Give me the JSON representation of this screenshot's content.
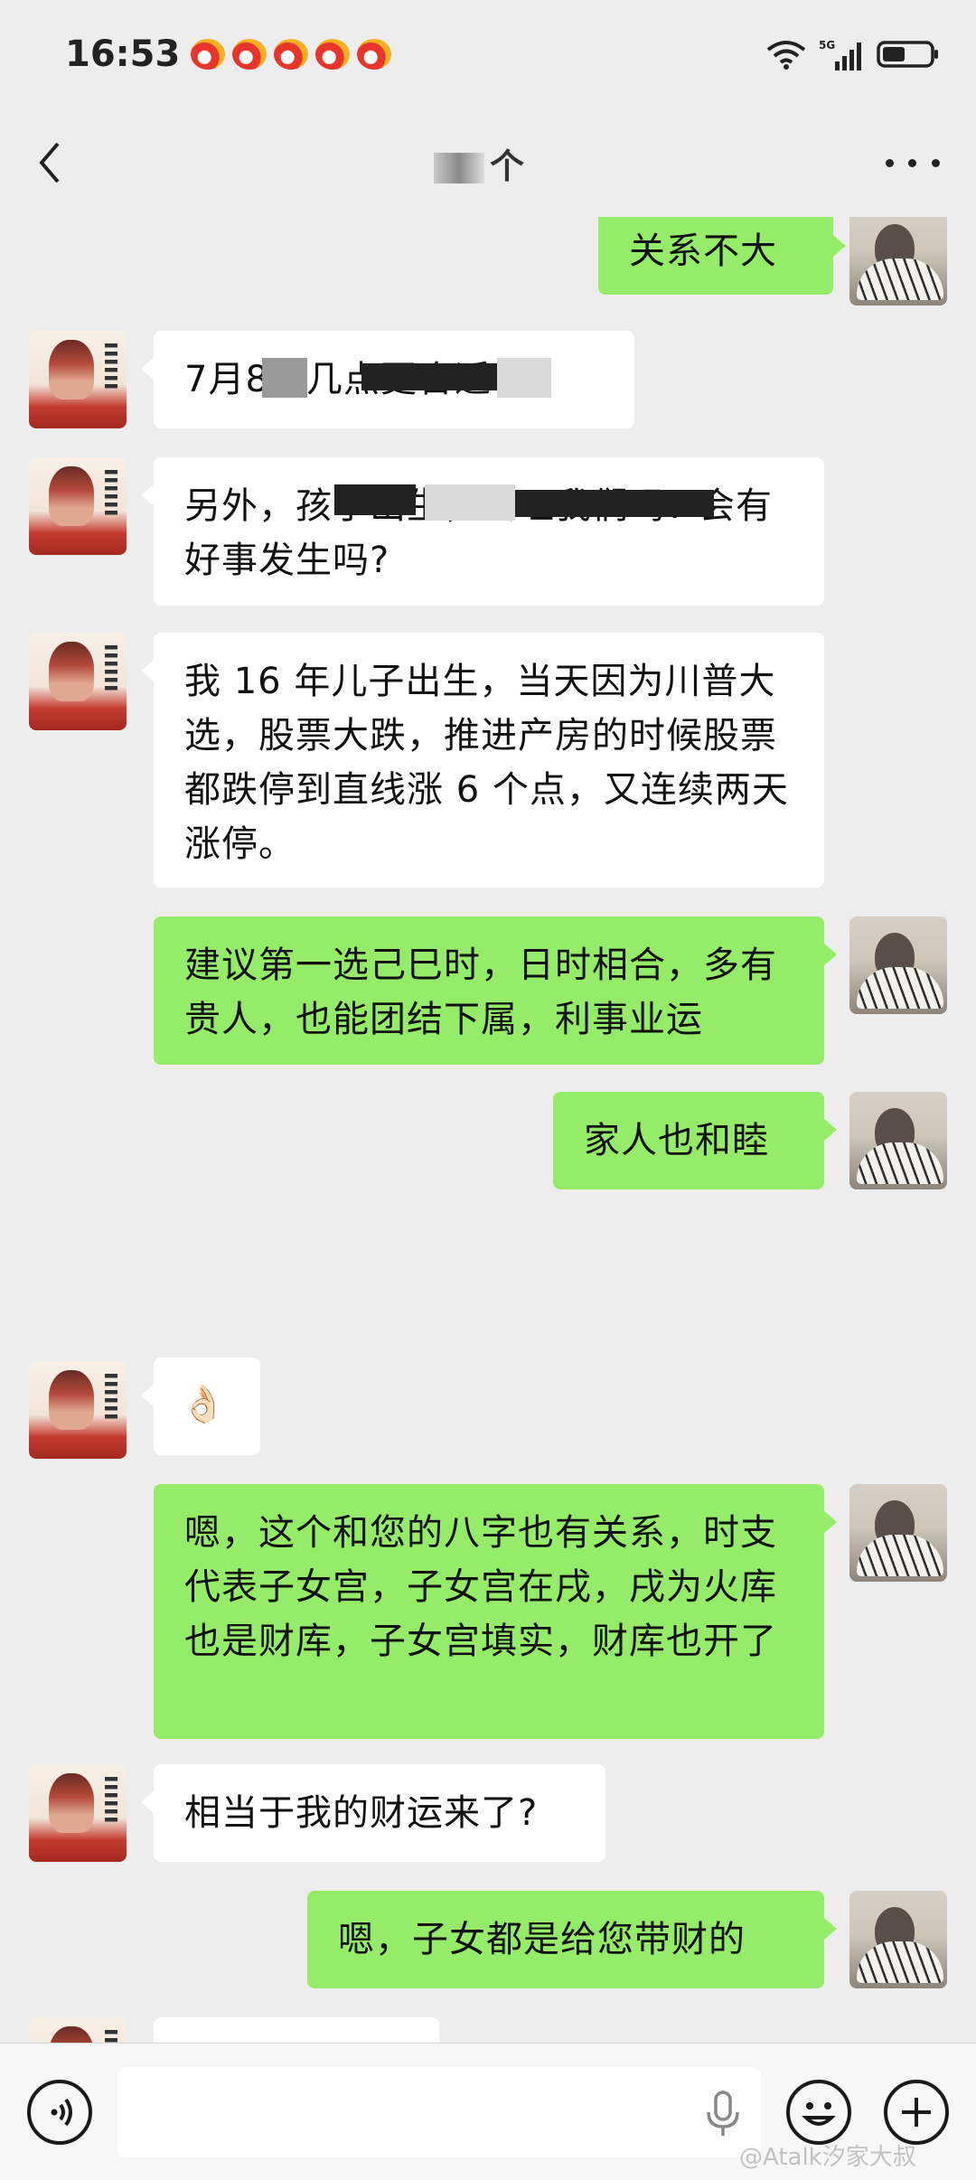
{
  "status_bar": {
    "time": "16:53",
    "network": "5G",
    "notification_icons": [
      "weibo-icon",
      "weibo-icon",
      "weibo-icon",
      "weibo-icon",
      "weibo-icon"
    ]
  },
  "nav": {
    "title": "个",
    "back_icon": "chevron-left-icon",
    "more_icon": "more-dots-icon"
  },
  "messages": [
    {
      "side": "out",
      "text": "关系不大"
    },
    {
      "side": "in",
      "text": "7月8日几点更合适呢?"
    },
    {
      "side": "in",
      "text": "另外，孩子出生，会旺我们吗? 会有好事发生吗?"
    },
    {
      "side": "in",
      "text": "我 16 年儿子出生，当天因为川普大选，股票大跌，推进产房的时候股票都跌停到直线涨 6 个点，又连续两天涨停。"
    },
    {
      "side": "out",
      "text": "建议第一选己巳时，日时相合，多有贵人，也能团结下属，利事业运"
    },
    {
      "side": "out",
      "text": "家人也和睦"
    },
    {
      "side": "in",
      "text": "👌🏻"
    },
    {
      "side": "out",
      "text": "嗯，这个和您的八字也有关系，时支代表子女宫，子女宫在戌，戌为火库也是财库，子女宫填实，财库也开了"
    },
    {
      "side": "in",
      "text": "相当于我的财运来了?"
    },
    {
      "side": "out",
      "text": "嗯，子女都是给您带财的"
    }
  ],
  "input_bar": {
    "voice_icon": "voice-icon",
    "mic_icon": "mic-icon",
    "emoji_icon": "emoji-icon",
    "plus_icon": "plus-icon"
  },
  "watermark": "@Atalk汐家大叔",
  "colors": {
    "background": "#ededed",
    "outgoing_bubble": "#95ec69",
    "incoming_bubble": "#ffffff"
  }
}
